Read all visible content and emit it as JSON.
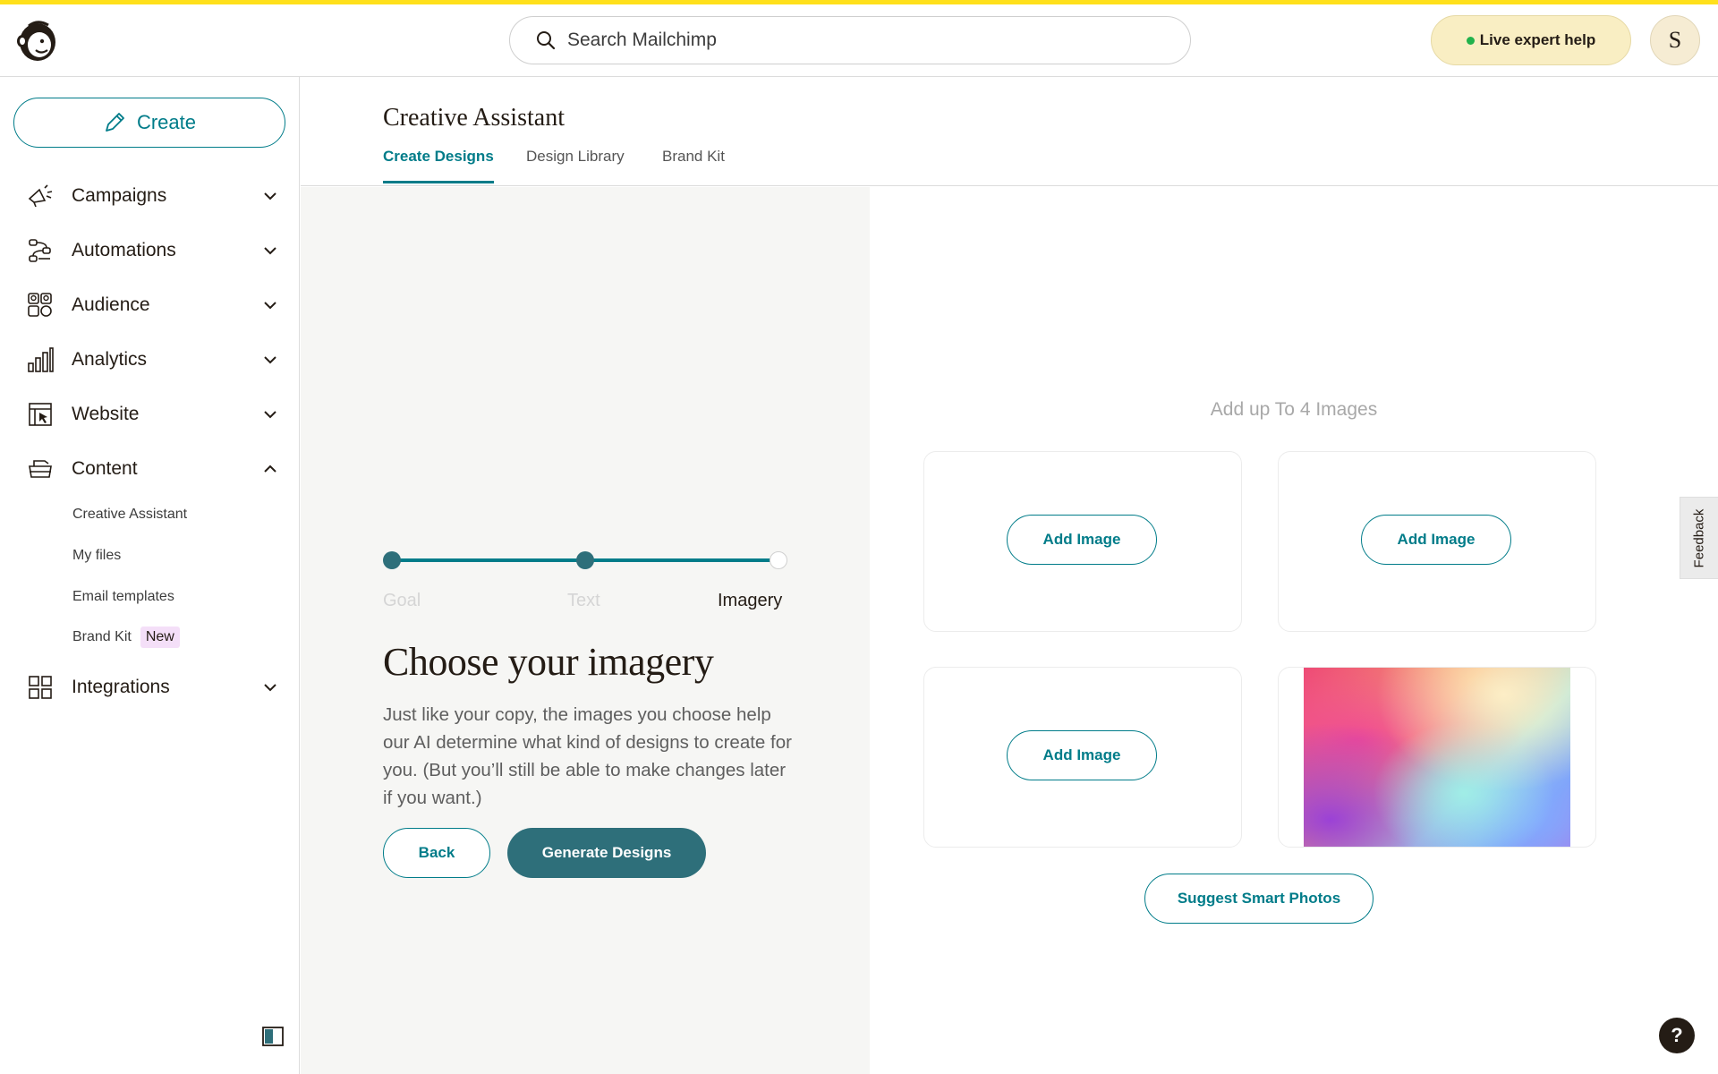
{
  "header": {
    "search_placeholder": "Search Mailchimp",
    "live_help_label": "Live expert help",
    "avatar_initial": "S"
  },
  "sidebar": {
    "create_label": "Create",
    "items": [
      {
        "label": "Campaigns",
        "icon": "megaphone-icon",
        "expanded": false
      },
      {
        "label": "Automations",
        "icon": "automation-flow-icon",
        "expanded": false
      },
      {
        "label": "Audience",
        "icon": "audience-icon",
        "expanded": false
      },
      {
        "label": "Analytics",
        "icon": "bar-chart-icon",
        "expanded": false
      },
      {
        "label": "Website",
        "icon": "website-icon",
        "expanded": false
      },
      {
        "label": "Content",
        "icon": "content-icon",
        "expanded": true
      },
      {
        "label": "Integrations",
        "icon": "grid-icon",
        "expanded": false
      }
    ],
    "content_subitems": [
      {
        "label": "Creative Assistant"
      },
      {
        "label": "My files"
      },
      {
        "label": "Email templates"
      },
      {
        "label": "Brand Kit",
        "badge": "New"
      }
    ]
  },
  "page": {
    "title": "Creative Assistant",
    "tabs": [
      {
        "label": "Create Designs",
        "active": true
      },
      {
        "label": "Design Library",
        "active": false
      },
      {
        "label": "Brand Kit",
        "active": false
      }
    ]
  },
  "wizard": {
    "steps": [
      {
        "label": "Goal",
        "done": true
      },
      {
        "label": "Text",
        "done": true
      },
      {
        "label": "Imagery",
        "done": false,
        "current": true
      }
    ],
    "heading": "Choose your imagery",
    "description": "Just like your copy, the images you choose help our AI determine what kind of designs to create for you. (But you’ll still be able to make changes later if you want.)",
    "back_label": "Back",
    "generate_label": "Generate Designs"
  },
  "images": {
    "label": "Add up To 4 Images",
    "slots": [
      {
        "button_label": "Add Image",
        "filled": false
      },
      {
        "button_label": "Add Image",
        "filled": false
      },
      {
        "button_label": "Add Image",
        "filled": false
      },
      {
        "filled": true
      }
    ],
    "suggest_label": "Suggest Smart Photos"
  },
  "feedback_label": "Feedback",
  "help_label": "?",
  "colors": {
    "accent": "#007c89",
    "accent_dark": "#2e6f7a",
    "brand_yellow": "#ffe01b",
    "badge_new": "#f4dff8"
  }
}
